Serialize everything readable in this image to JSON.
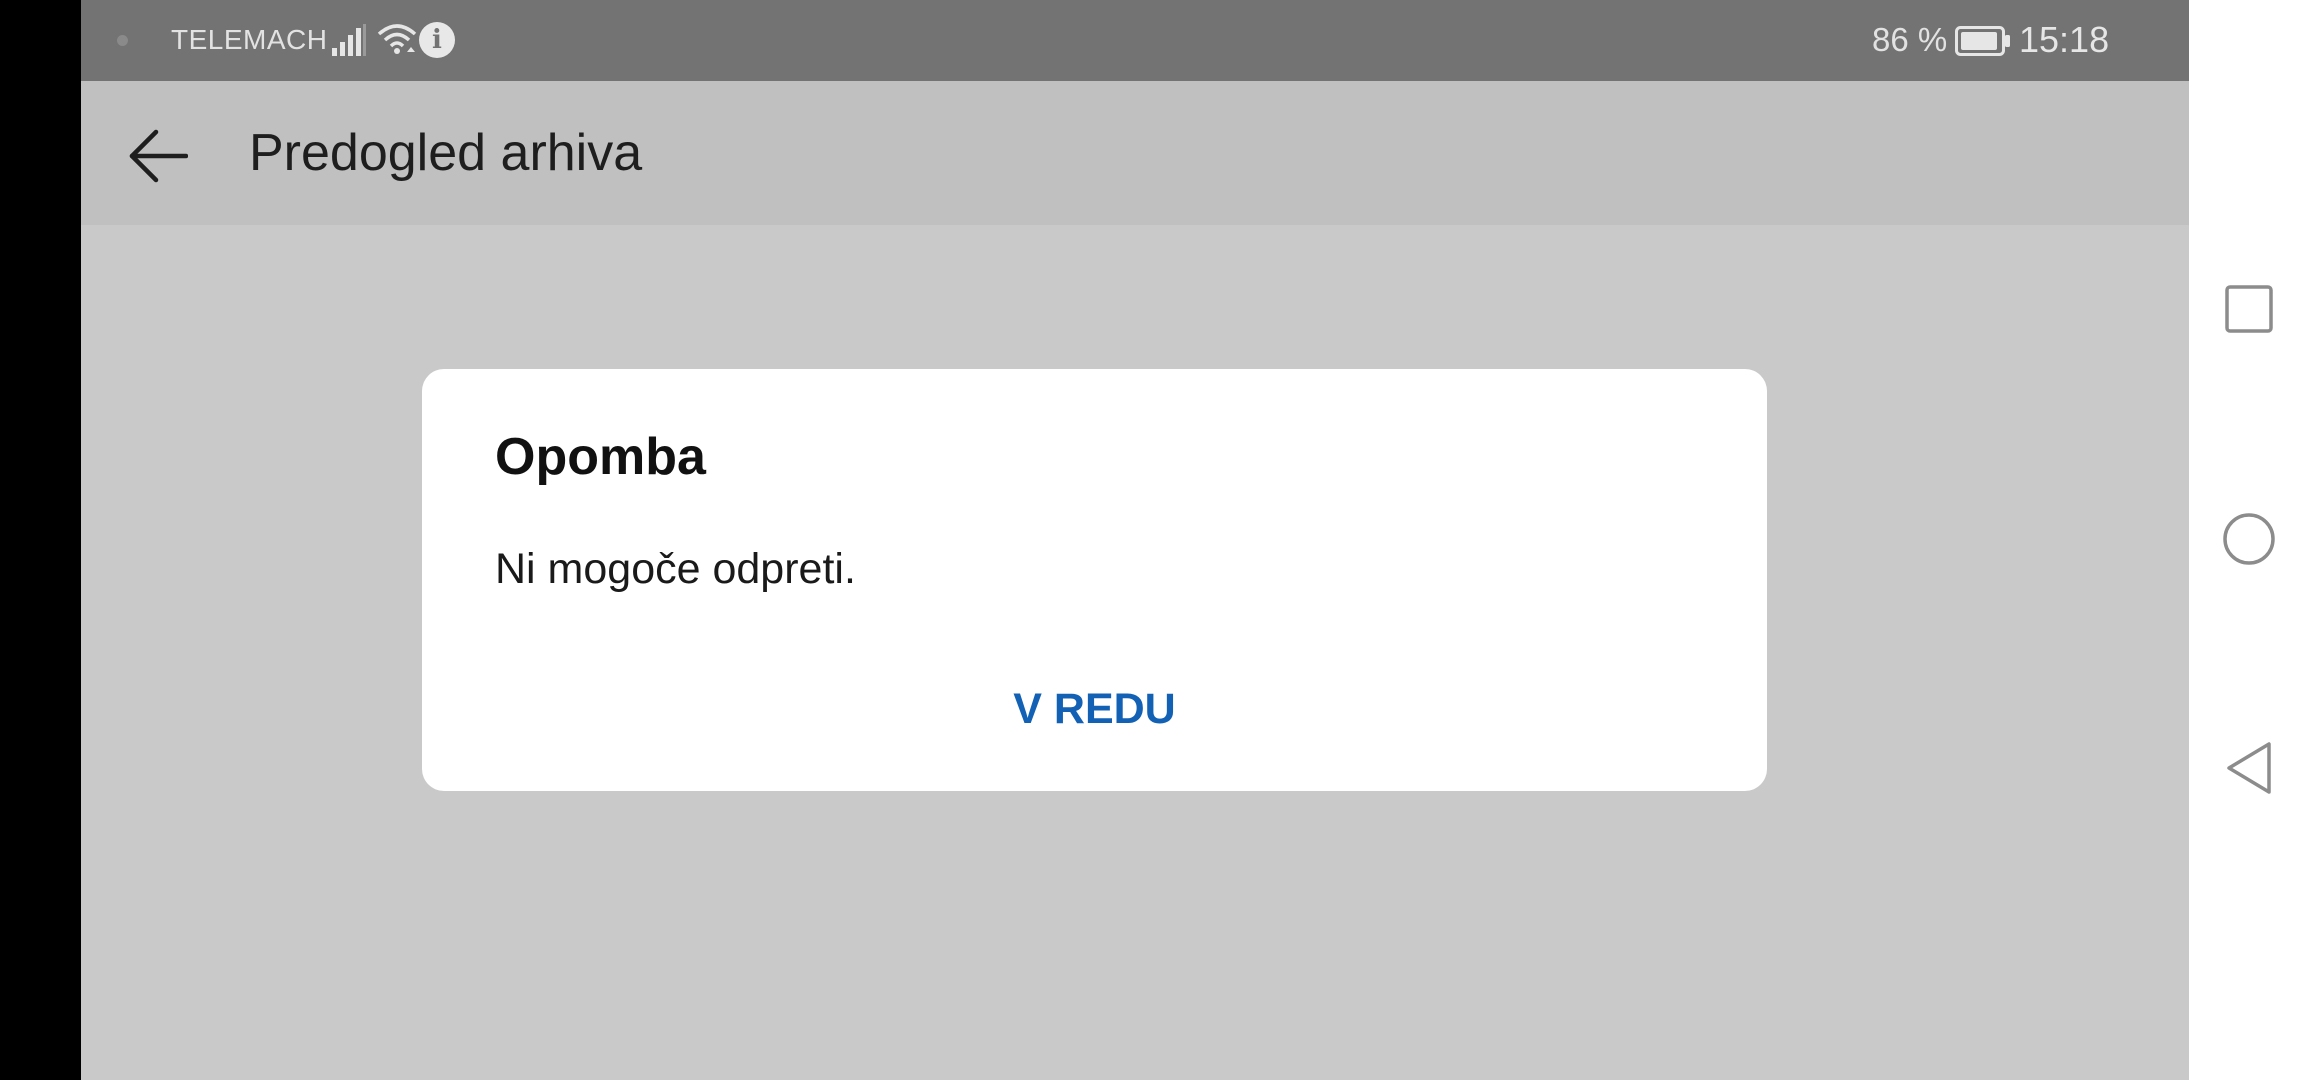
{
  "status_bar": {
    "carrier": "TELEMACH",
    "battery_percent": "86 %",
    "time": "15:18",
    "icons": [
      "status-dot-icon",
      "signal-icon",
      "wifi-icon",
      "info-icon",
      "battery-icon"
    ],
    "info_glyph": "i"
  },
  "toolbar": {
    "title": "Predogled arhiva",
    "back_icon": "arrow-left-icon"
  },
  "dialog": {
    "title": "Opomba",
    "message": "Ni mogoče odpreti.",
    "ok_label": "V REDU",
    "ok_color": "#1261b5"
  },
  "nav_bar": {
    "buttons": [
      "recents-square-icon",
      "home-circle-icon",
      "back-triangle-icon"
    ]
  },
  "colors": {
    "status_bar_bg": "#737373",
    "toolbar_bg": "#c0c0c0",
    "content_bg": "#c9c9c9",
    "dialog_bg": "#ffffff",
    "nav_bar_bg": "#ffffff"
  }
}
